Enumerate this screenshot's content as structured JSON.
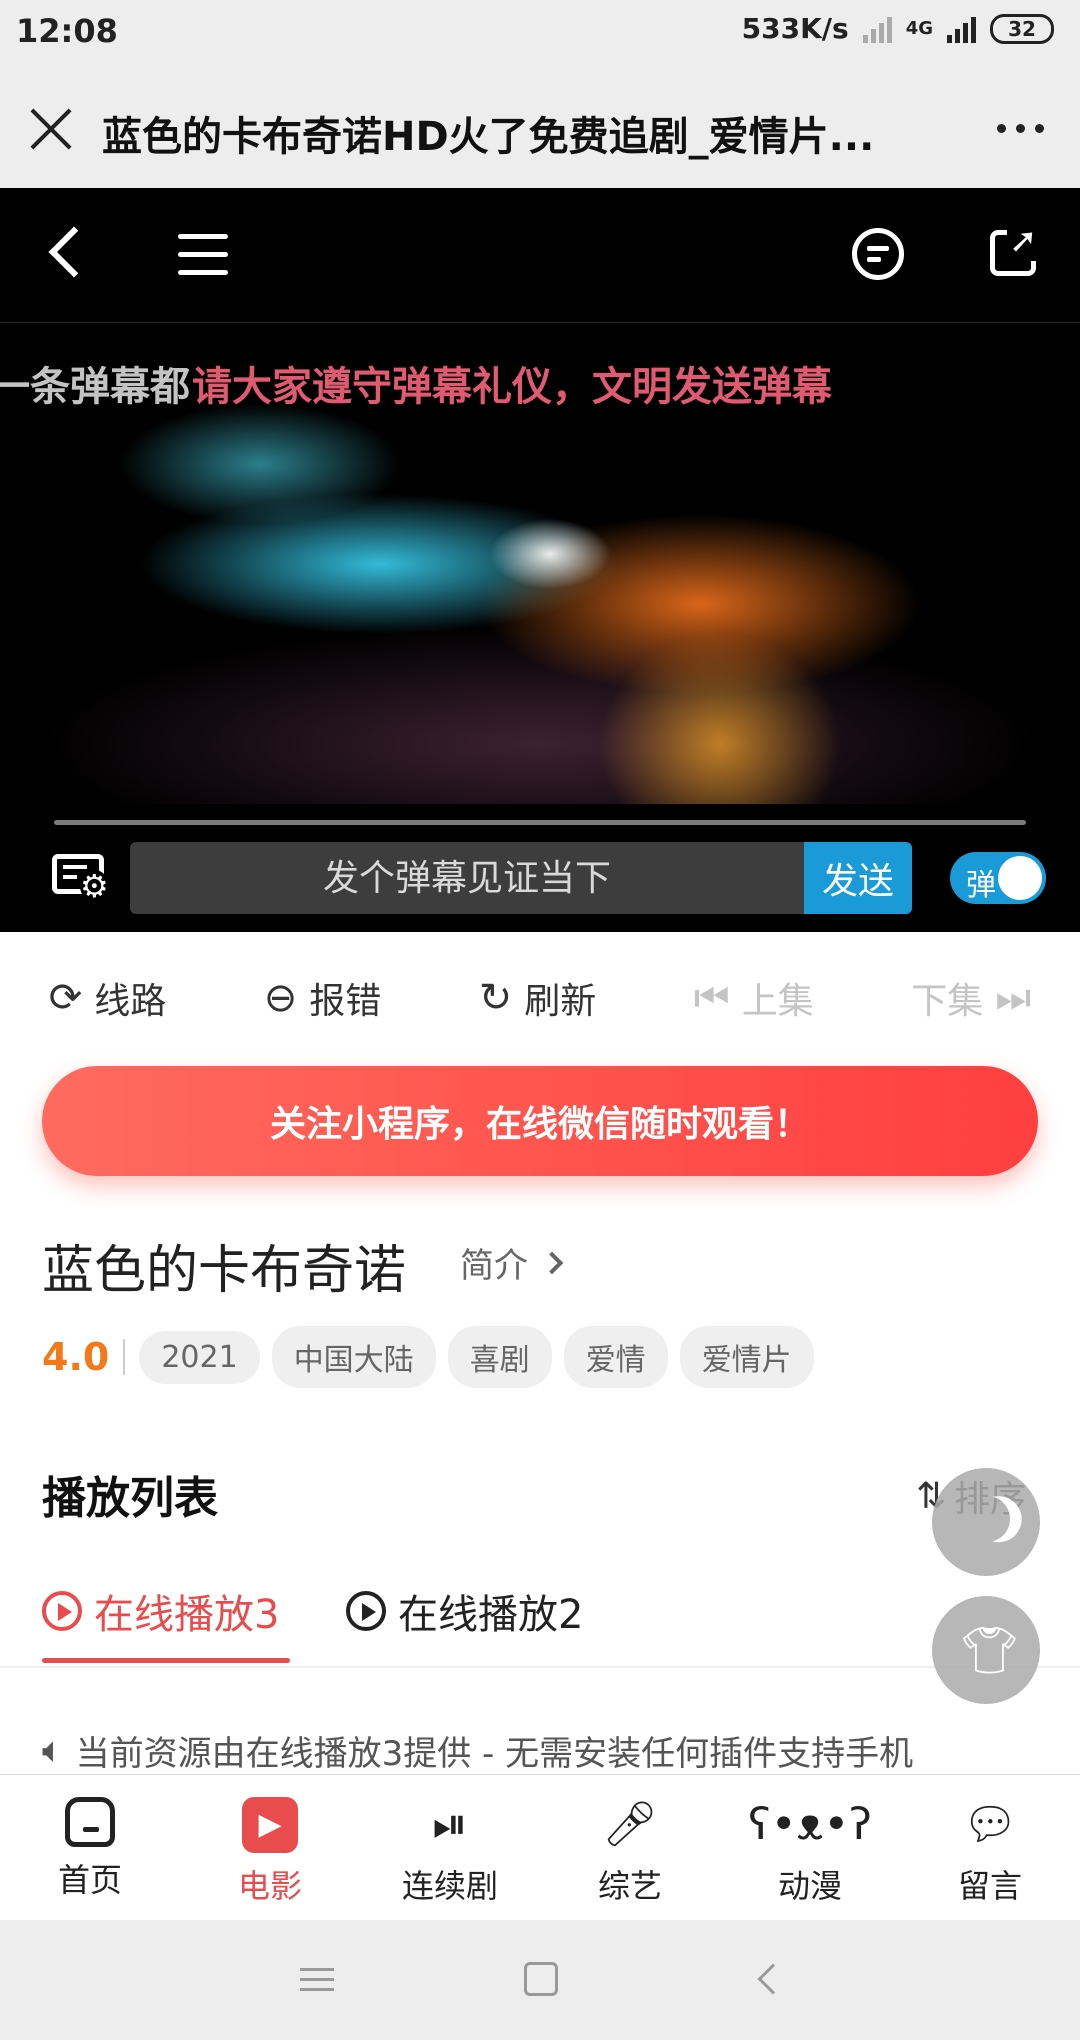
{
  "status": {
    "time": "12:08",
    "speed": "533K/s",
    "network": "4G",
    "battery": "32"
  },
  "titlebar": {
    "title": "蓝色的卡布奇诺HD火了免费追剧_爱情片..."
  },
  "player": {
    "danmaku_white": "一条弹幕都",
    "danmaku_red": "请大家遵守弹幕礼仪，文明发送弹幕",
    "input_placeholder": "发个弹幕见证当下",
    "send_label": "发送",
    "toggle_label": "弹",
    "toggle_on": true
  },
  "controls": {
    "items": [
      {
        "label": "线路",
        "icon": "refresh-route-icon",
        "glyph": "⟳"
      },
      {
        "label": "报错",
        "icon": "minus-circle-icon",
        "glyph": "⊖"
      },
      {
        "label": "刷新",
        "icon": "refresh-icon",
        "glyph": "↻"
      },
      {
        "label": "上集",
        "icon": "previous-episode-icon",
        "glyph": "⏮"
      },
      {
        "label": "下集",
        "icon": "next-episode-icon",
        "glyph": "⏭"
      }
    ]
  },
  "promo": {
    "label": "关注小程序，在线微信随时观看！"
  },
  "movie": {
    "title": "蓝色的卡布奇诺",
    "intro_label": "简介",
    "rating": "4.0",
    "tags": [
      "2021",
      "中国大陆",
      "喜剧",
      "爱情",
      "爱情片"
    ]
  },
  "playlist": {
    "title": "播放列表",
    "sort_label": "排序",
    "tabs": [
      {
        "label": "在线播放3",
        "active": true
      },
      {
        "label": "在线播放2",
        "active": false
      }
    ],
    "source_text": "当前资源由在线播放3提供 - 无需安装任何插件支持手机"
  },
  "bottom_nav": {
    "items": [
      {
        "label": "首页",
        "icon": "home-icon",
        "active": false
      },
      {
        "label": "电影",
        "icon": "movie-icon",
        "active": true
      },
      {
        "label": "连续剧",
        "icon": "tv-series-icon",
        "active": false
      },
      {
        "label": "综艺",
        "icon": "microphone-icon",
        "active": false
      },
      {
        "label": "动漫",
        "icon": "bear-face-icon",
        "active": false
      },
      {
        "label": "留言",
        "icon": "message-icon",
        "active": false
      }
    ]
  },
  "colors": {
    "accent_red": "#e84c4c",
    "send_blue": "#1a9ad6",
    "rating_orange": "#f27a1a"
  }
}
